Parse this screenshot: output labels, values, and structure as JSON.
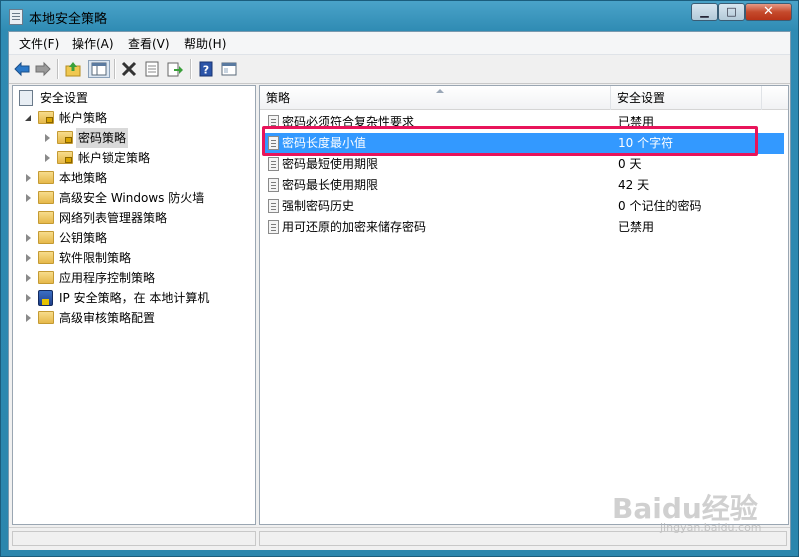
{
  "window": {
    "title": "本地安全策略",
    "controls": {
      "minimize": "▁",
      "maximize": "□",
      "close": "✕"
    }
  },
  "menu": [
    {
      "label": "文件(F)"
    },
    {
      "label": "操作(A)"
    },
    {
      "label": "查看(V)"
    },
    {
      "label": "帮助(H)"
    }
  ],
  "toolbar": {
    "buttons": [
      "back-icon",
      "forward-icon",
      "up-folder-icon",
      "show-tree-icon",
      "delete-icon",
      "properties-icon",
      "export-icon",
      "help-icon",
      "console-icon"
    ]
  },
  "tree": {
    "root": "安全设置",
    "items": [
      {
        "label": "帐户策略"
      },
      {
        "label": "密码策略"
      },
      {
        "label": "帐户锁定策略"
      },
      {
        "label": "本地策略"
      },
      {
        "label": "高级安全 Windows 防火墙"
      },
      {
        "label": "网络列表管理器策略"
      },
      {
        "label": "公钥策略"
      },
      {
        "label": "软件限制策略"
      },
      {
        "label": "应用程序控制策略"
      },
      {
        "label": "IP 安全策略，在 本地计算机"
      },
      {
        "label": "高级审核策略配置"
      }
    ]
  },
  "list": {
    "columns": {
      "policy": "策略",
      "setting": "安全设置"
    },
    "rows": [
      {
        "name": "密码必须符合复杂性要求",
        "setting": "已禁用"
      },
      {
        "name": "密码长度最小值",
        "setting": "10 个字符"
      },
      {
        "name": "密码最短使用期限",
        "setting": "0 天"
      },
      {
        "name": "密码最长使用期限",
        "setting": "42 天"
      },
      {
        "name": "强制密码历史",
        "setting": "0 个记住的密码"
      },
      {
        "name": "用可还原的加密来储存密码",
        "setting": "已禁用"
      }
    ],
    "selected_row": 1
  },
  "watermark": {
    "main": "Baidu经验",
    "sub": "jingyan.baidu.com"
  },
  "colors": {
    "selection": "#3399ff",
    "highlight_box": "#e8145a",
    "titlebar": "#2f8bb3"
  }
}
